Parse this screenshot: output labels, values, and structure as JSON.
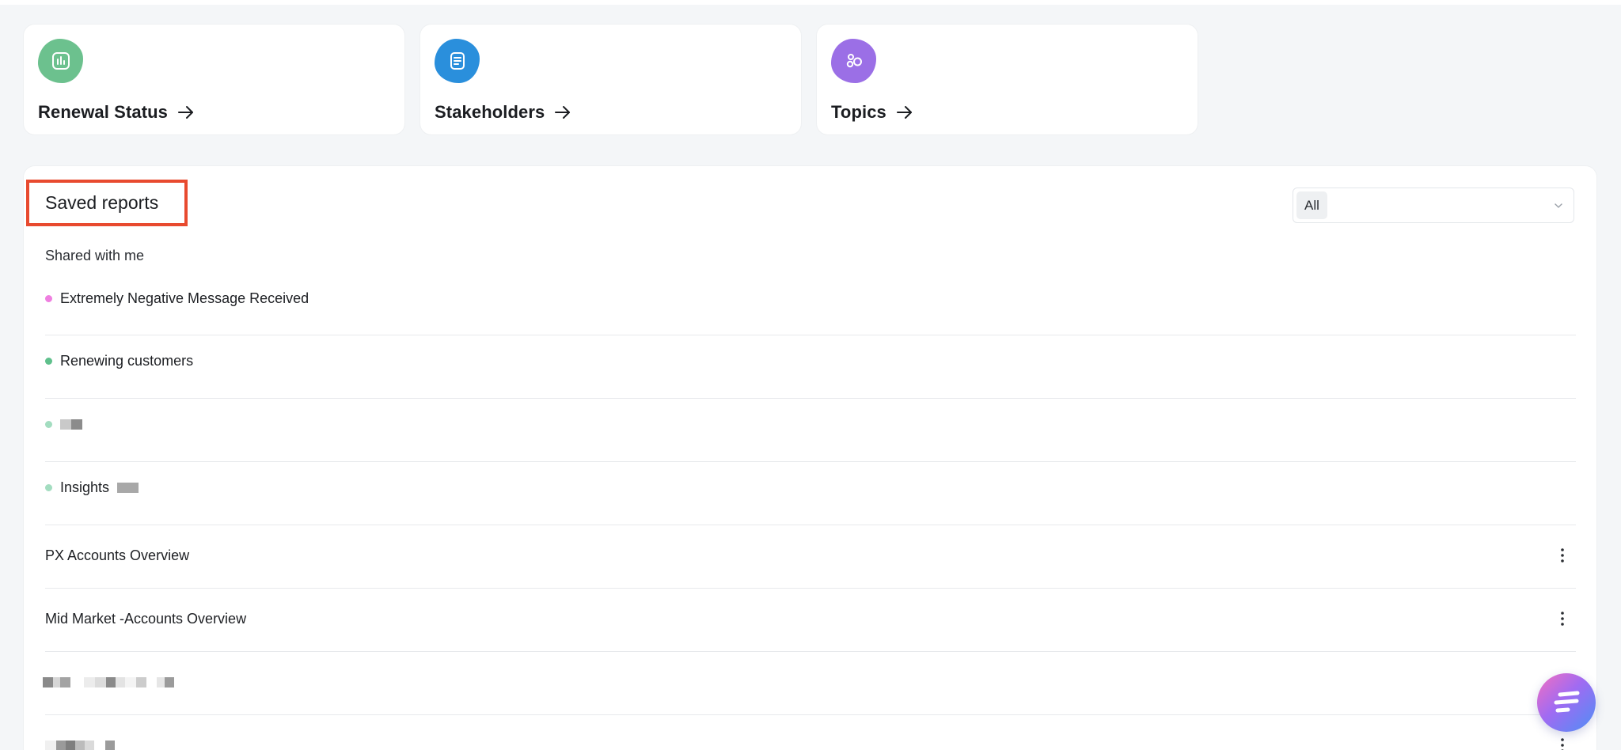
{
  "quick_links": [
    {
      "label": "Renewal Status",
      "icon": "bar-chart-icon",
      "icon_color": "#6cc18e"
    },
    {
      "label": "Stakeholders",
      "icon": "document-list-icon",
      "icon_color": "#2a8fdc"
    },
    {
      "label": "Topics",
      "icon": "bubbles-icon",
      "icon_color": "#9b6fe6"
    }
  ],
  "saved_reports": {
    "title": "Saved reports",
    "filter": {
      "value": "All"
    },
    "section_label": "Shared with me",
    "rows": [
      {
        "label": "Extremely Negative Message Received",
        "dot_color": "#ef7fe0"
      },
      {
        "label": "Renewing customers",
        "dot_color": "#5fc08c"
      },
      {
        "label": "",
        "dot_color": "#a3ddc0"
      },
      {
        "label": "Insights",
        "dot_color": "#a3ddc0"
      },
      {
        "label": "PX Accounts Overview",
        "menu": "more-vertical-icon"
      },
      {
        "label": "Mid Market -Accounts Overview",
        "menu": "more-vertical-icon"
      },
      {
        "label": "",
        "menu": "more-vertical-icon"
      },
      {
        "label": "",
        "menu": "more-vertical-icon"
      }
    ]
  },
  "highlight_color": "#e84a2f",
  "chat_launcher": {
    "icon": "chat-lines-icon"
  }
}
